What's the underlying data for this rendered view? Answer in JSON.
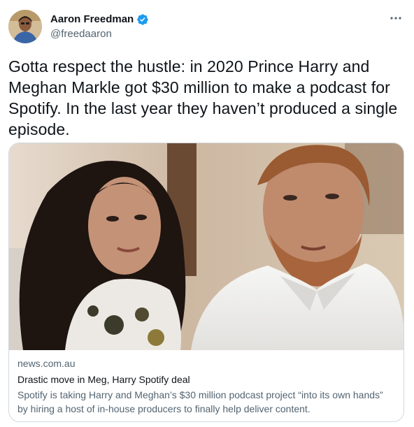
{
  "author": {
    "display_name": "Aaron Freedman",
    "handle": "@freedaaron",
    "avatar_icon": "user-avatar",
    "verified_icon": "verified-badge-icon",
    "verified_color": "#1d9bf0"
  },
  "tweet": {
    "text": "Gotta respect the hustle: in 2020 Prince Harry and Meghan Markle got $30 million to make a podcast for Spotify. In the last year they haven’t produced a single episode."
  },
  "menu": {
    "icon": "more-options-icon"
  },
  "card": {
    "domain": "news.com.au",
    "title": "Drastic move in Meg, Harry Spotify deal",
    "description": "Spotify is taking Harry and Meghan’s $30 million podcast project “into its own hands” by hiring a host of in-house producers to finally help deliver content."
  },
  "colors": {
    "text_primary": "#0f1419",
    "text_secondary": "#536471",
    "border": "#cfd9de"
  }
}
